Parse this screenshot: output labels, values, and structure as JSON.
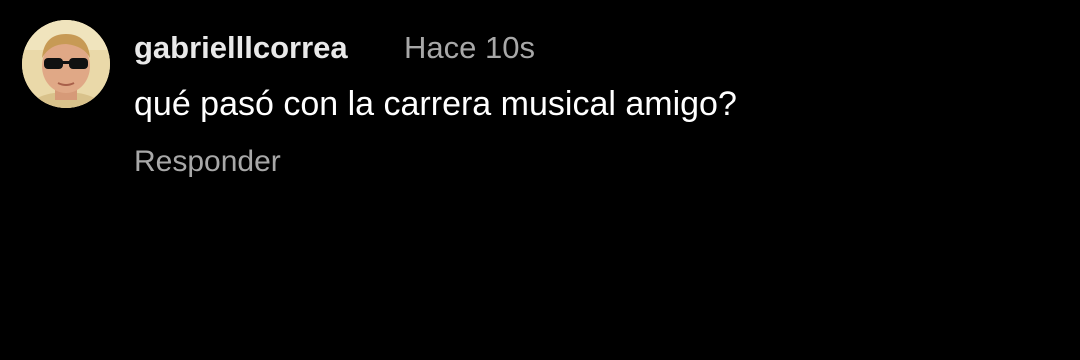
{
  "comment": {
    "username": "gabrielllcorrea",
    "timestamp": "Hace 10s",
    "text": "qué pasó con la carrera musical amigo?",
    "reply_label": "Responder",
    "avatar_icon": "profile-photo"
  },
  "colors": {
    "background": "#000000",
    "username": "#e9e9e9",
    "text": "#ffffff",
    "secondary": "#a8a8a8"
  }
}
